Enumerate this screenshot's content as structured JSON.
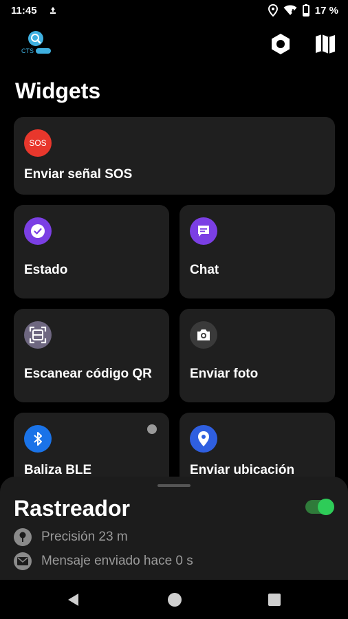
{
  "status_bar": {
    "time": "11:45",
    "battery_percent": "17 %"
  },
  "header": {
    "logo_text": "CTS",
    "icons": [
      "settings-icon",
      "map-icon"
    ]
  },
  "page_title": "Widgets",
  "widgets": {
    "sos": {
      "badge": "SOS",
      "label": "Enviar señal SOS",
      "icon_color": "#e8372c"
    },
    "estado": {
      "label": "Estado",
      "icon_color": "#7b3fe4"
    },
    "chat": {
      "label": "Chat",
      "icon_color": "#7b3fe4"
    },
    "qr": {
      "label": "Escanear código QR",
      "icon_color": "#6e6780"
    },
    "foto": {
      "label": "Enviar foto",
      "icon_color": "#3a3a3a"
    },
    "ble": {
      "label": "Baliza BLE",
      "icon_color": "#1a73e8",
      "status_dot_color": "#9a9a9a"
    },
    "ubicacion": {
      "label": "Enviar ubicación",
      "icon_color": "#2f5fe0"
    }
  },
  "tracker": {
    "title": "Rastreador",
    "enabled": true,
    "accuracy": "Precisión 23 m",
    "last_message": "Mensaje enviado hace 0 s",
    "toggle_color": "#2ecc58"
  },
  "nav": {
    "icons": [
      "back-icon",
      "home-icon",
      "recents-icon"
    ]
  }
}
